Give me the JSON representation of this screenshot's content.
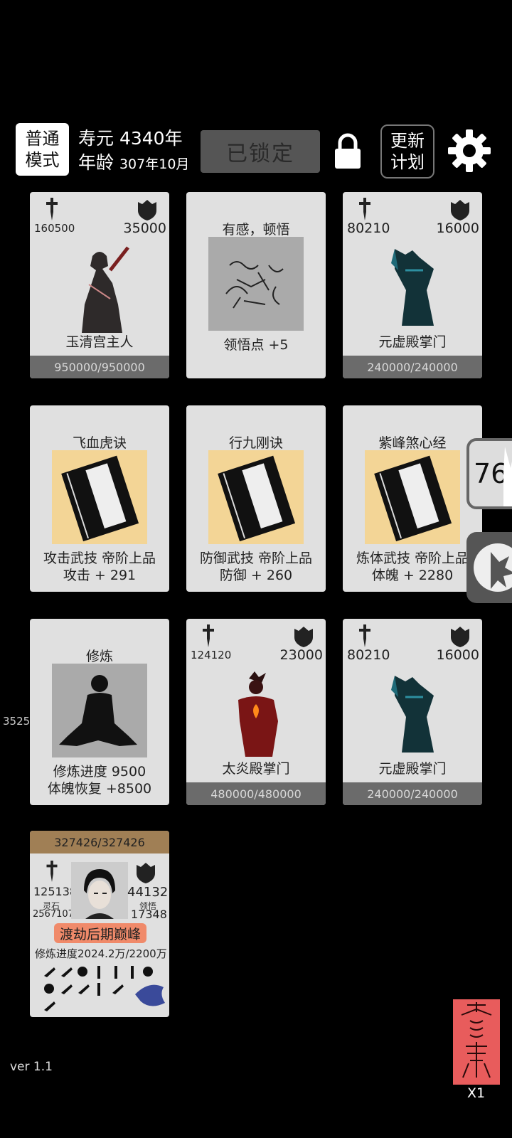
{
  "top_bar": {
    "mode_line1": "普通",
    "mode_line2": "模式",
    "lifespan": "寿元 4340年",
    "age_label": "年龄",
    "age_value": "307年10月",
    "locked_label": "已锁定",
    "plan_line1": "更新",
    "plan_line2": "计划"
  },
  "cards": {
    "c1": {
      "atk": "160500",
      "def": "35000",
      "name": "玉清宫主人",
      "hp": "950000/950000"
    },
    "c2": {
      "title": "有感，顿悟",
      "line1": "领悟点  +5"
    },
    "c3": {
      "atk": "80210",
      "def": "16000",
      "name": "元虚殿掌门",
      "hp": "240000/240000"
    },
    "c4": {
      "title": "飞血虎诀",
      "line1": "攻击武技  帝阶上品",
      "line2": "攻击 + 291"
    },
    "c5": {
      "title": "行九刚诀",
      "line1": "防御武技  帝阶上品",
      "line2": "防御 + 260"
    },
    "c6": {
      "title": "紫峰煞心经",
      "line1": "炼体武技  帝阶上品",
      "line2": "体魄 + 2280"
    },
    "c7": {
      "title": "修炼",
      "line1": "修炼进度  9500",
      "line2": "体魄恢复  +8500"
    },
    "c8": {
      "atk": "124120",
      "def": "23000",
      "name": "太炎殿掌门",
      "hp": "480000/480000"
    },
    "c9": {
      "atk": "80210",
      "def": "16000",
      "name": "元虚殿掌门",
      "hp": "240000/240000"
    }
  },
  "player": {
    "hp": "327426/327426",
    "atk": "125138",
    "spirit_stone_label": "灵石",
    "spirit_stone": "2567107",
    "def": "44132",
    "insight_label": "领悟",
    "insight": "17348",
    "realm": "渡劫后期巅峰",
    "progress": "修炼进度2024.2万/2200万"
  },
  "side": {
    "count": "76",
    "left_number": "3525"
  },
  "footer": {
    "version": "ver 1.1",
    "talisman_count": "X1"
  },
  "icons": {
    "attack": "sword-icon",
    "defense": "shield-icon",
    "lock": "lock-icon",
    "settings": "gear-icon"
  }
}
